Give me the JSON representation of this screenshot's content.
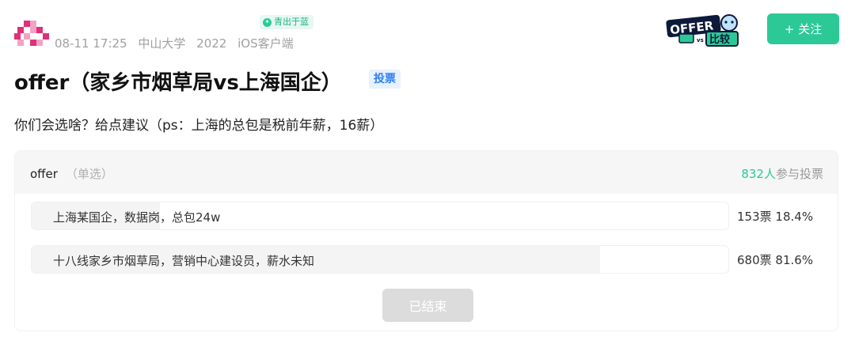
{
  "post": {
    "badge": "青出于蓝",
    "date": "08-11 17:25",
    "school": "中山大学",
    "year": "2022",
    "client": "iOS客户端",
    "follow_label": "关注",
    "title": "offer（家乡市烟草局vs上海国企）",
    "tag": "投票",
    "description": "你们会选啥？给点建议（ps：上海的总包是税前年薪，16薪）"
  },
  "logo": {
    "text_main": "OFFER",
    "text_sub": "比较",
    "vs": "vs"
  },
  "poll": {
    "name": "offer",
    "type": "（单选）",
    "participants": "832人",
    "participants_suffix": "参与投票",
    "ended_label": "已结束",
    "options": [
      {
        "label": "上海某国企，数据岗，总包24w",
        "votes": "153票",
        "percent": "18.4%",
        "fraction": 0.184
      },
      {
        "label": "十八线家乡市烟草局，营销中心建设员，薪水未知",
        "votes": "680票",
        "percent": "81.6%",
        "fraction": 0.816
      }
    ]
  },
  "colors": {
    "accent": "#2cc996",
    "tag_blue": "#2f7ff0",
    "avatar_pink": "#e0307a"
  }
}
